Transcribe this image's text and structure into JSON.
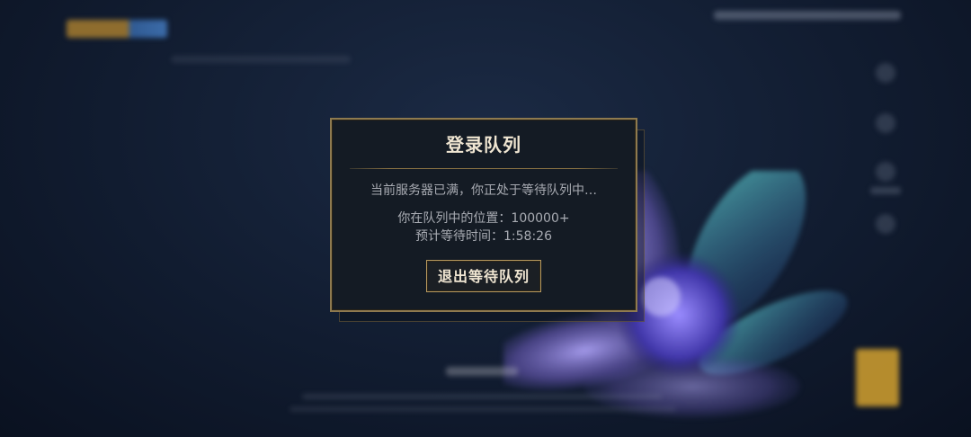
{
  "dialog": {
    "title": "登录队列",
    "message": "当前服务器已满，你正处于等待队列中…",
    "position_label": "你在队列中的位置：",
    "position_value": "100000+",
    "eta_label": "预计等待时间：",
    "eta_value": "1:58:26",
    "leave_button_label": "退出等待队列"
  },
  "colors": {
    "gold_border": "#8e7a4f",
    "title_text": "#f0e6d2",
    "body_text": "#a8abb2",
    "panel_bg": "#141b24"
  }
}
